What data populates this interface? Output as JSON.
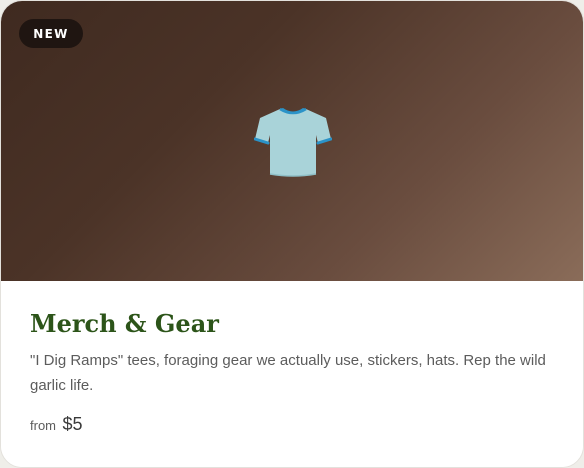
{
  "card": {
    "badge": "NEW",
    "image_icon": "t-shirt-icon",
    "title": "Merch & Gear",
    "description": "\"I Dig Ramps\" tees, foraging gear we actually use, stickers, hats. Rep the wild garlic life.",
    "price_prefix": "from",
    "price": "$5"
  },
  "colors": {
    "title": "#2c5419",
    "badge_bg": "#1f1511",
    "hero_gradient_start": "#3f2a20",
    "hero_gradient_end": "#8a6c59",
    "tshirt_fill": "#a9d3d9",
    "tshirt_trim": "#2b93c8"
  }
}
